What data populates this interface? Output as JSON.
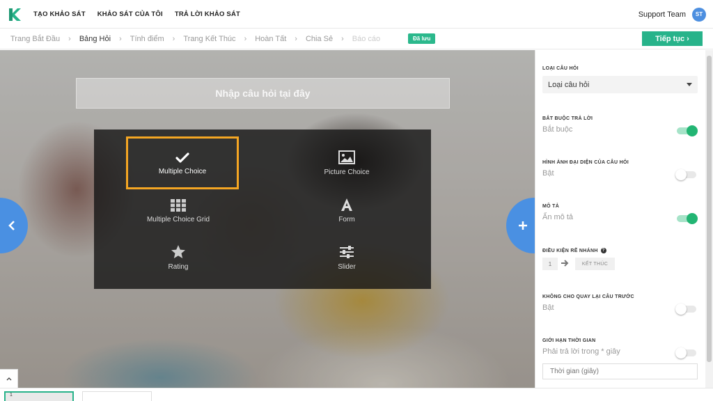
{
  "nav": {
    "links": [
      "TẠO KHẢO SÁT",
      "KHẢO SÁT CỦA TÔI",
      "TRẢ LỜI KHẢO SÁT"
    ],
    "user_name": "Support Team",
    "avatar_initials": "ST"
  },
  "breadcrumb": {
    "items": [
      "Trang Bắt Đầu",
      "Bảng Hỏi",
      "Tính điểm",
      "Trang Kết Thúc",
      "Hoàn Tất",
      "Chia Sẻ",
      "Báo cáo"
    ],
    "separator": "›",
    "saved_badge": "Đã lưu",
    "continue_label": "Tiếp tục ›"
  },
  "editor": {
    "question_placeholder": "Nhập câu hỏi tại đây",
    "question_types": [
      {
        "label": "Multiple Choice",
        "icon": "check-icon",
        "selected": true
      },
      {
        "label": "Picture Choice",
        "icon": "image-icon",
        "selected": false
      },
      {
        "label": "Multiple Choice Grid",
        "icon": "grid-icon",
        "selected": false
      },
      {
        "label": "Form",
        "icon": "letter-a-icon",
        "selected": false
      },
      {
        "label": "Rating",
        "icon": "star-icon",
        "selected": false
      },
      {
        "label": "Slider",
        "icon": "sliders-icon",
        "selected": false
      }
    ],
    "accent_color": "#f5a623",
    "nav_color": "#4a90e2"
  },
  "settings": {
    "question_type": {
      "title": "LOẠI CÂU HỎI",
      "value": "Loại câu hỏi"
    },
    "required": {
      "title": "BẮT BUỘC TRẢ LỜI",
      "sub": "Bắt buộc",
      "on": true
    },
    "question_image": {
      "title": "HÌNH ẢNH ĐẠI DIỆN CỦA CÂU HỎI",
      "sub": "Bật",
      "on": false
    },
    "description": {
      "title": "MÔ TẢ",
      "sub": "Ẩn mô tả",
      "on": true
    },
    "branching": {
      "title": "ĐIỀU KIỆN RẼ NHÁNH",
      "from": "1",
      "to": "KẾT THÚC"
    },
    "no_back": {
      "title": "KHÔNG CHO QUAY LẠI CÂU TRƯỚC",
      "sub": "Bật",
      "on": false
    },
    "time_limit": {
      "title": "GIỚI HẠN THỜI GIAN",
      "sub": "Phải trả lời trong * giây",
      "on": false,
      "placeholder": "Thời gian (giây)"
    },
    "toggle_on_color": "#22b573"
  },
  "bottom": {
    "slide_number": "1"
  }
}
